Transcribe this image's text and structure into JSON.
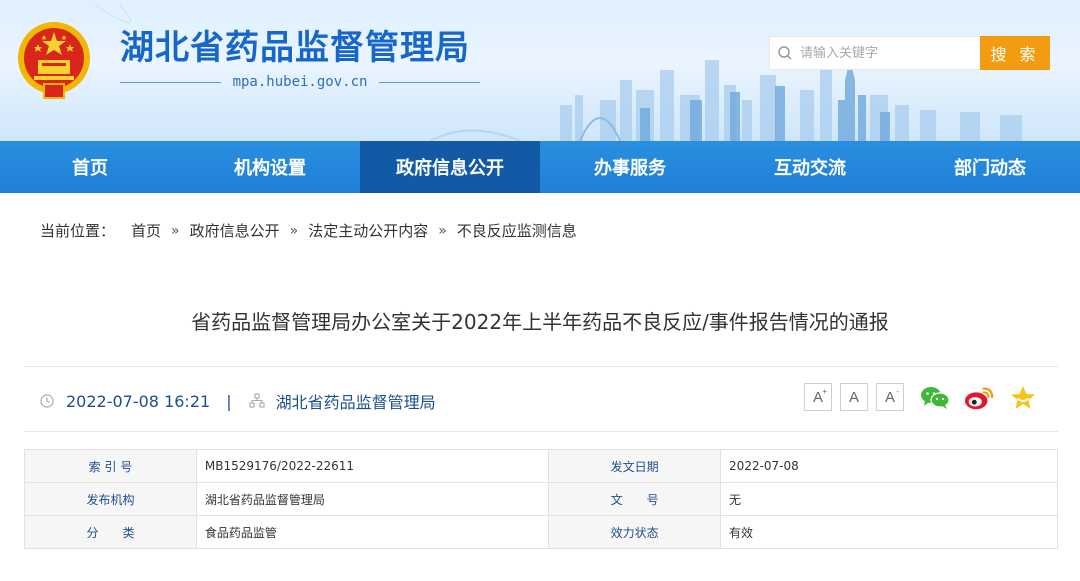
{
  "header": {
    "site_title": "湖北省药品监督管理局",
    "site_domain": "mpa.hubei.gov.cn",
    "search_placeholder": "请输入关键字",
    "search_button": "搜 索"
  },
  "nav": {
    "items": [
      {
        "label": "首页"
      },
      {
        "label": "机构设置"
      },
      {
        "label": "政府信息公开"
      },
      {
        "label": "办事服务"
      },
      {
        "label": "互动交流"
      },
      {
        "label": "部门动态"
      }
    ]
  },
  "breadcrumb": {
    "label": "当前位置：",
    "separator": "»",
    "items": [
      "首页",
      "政府信息公开",
      "法定主动公开内容",
      "不良反应监测信息"
    ]
  },
  "article": {
    "title": "省药品监督管理局办公室关于2022年上半年药品不良反应/事件报告情况的通报",
    "datetime": "2022-07-08 16:21",
    "meta_divider": "|",
    "publisher": "湖北省药品监督管理局",
    "font_buttons": [
      "A",
      "A",
      "A"
    ]
  },
  "info_table": {
    "rows": [
      {
        "k1": "索 引 号",
        "v1": "MB1529176/2022-22611",
        "k2": "发文日期",
        "v2": "2022-07-08"
      },
      {
        "k1": "发布机构",
        "v1": "湖北省药品监督管理局",
        "k2": "文　　号",
        "v2": "无"
      },
      {
        "k1": "分　　类",
        "v1": "食品药品监管",
        "k2": "效力状态",
        "v2": "有效"
      }
    ]
  },
  "colors": {
    "brand_blue": "#1867c8",
    "nav_blue": "#1e7fd6",
    "nav_active": "#135aa6",
    "search_orange": "#f39c12"
  },
  "icons": {
    "emblem": "national-emblem",
    "search": "search-icon",
    "clock": "clock-icon",
    "org": "org-icon",
    "wechat": "wechat-icon",
    "weibo": "weibo-icon",
    "favorite": "star-icon"
  }
}
